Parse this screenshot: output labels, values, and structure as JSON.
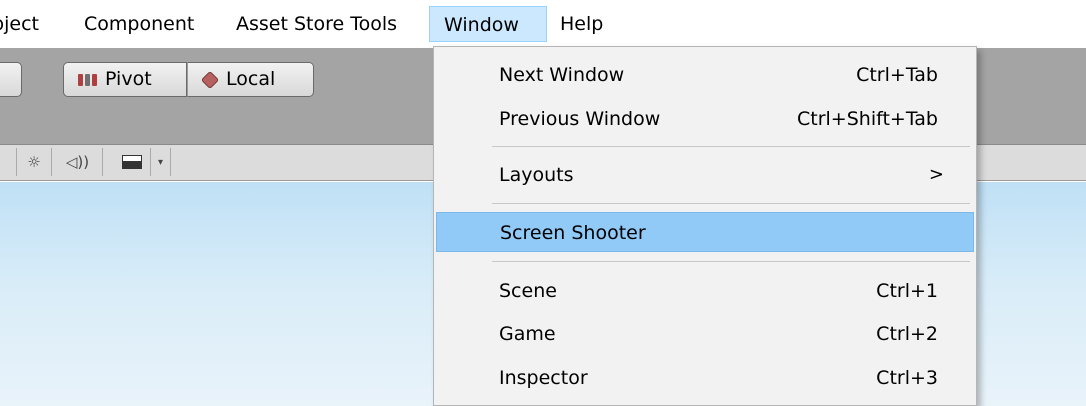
{
  "menubar": {
    "items": [
      "Project",
      "Component",
      "Asset Store Tools",
      "Window",
      "Help"
    ]
  },
  "toolbar": {
    "pivot_label": "Pivot",
    "local_label": "Local"
  },
  "window_menu": {
    "items": [
      {
        "label": "Next Window",
        "shortcut": "Ctrl+Tab"
      },
      {
        "label": "Previous Window",
        "shortcut": "Ctrl+Shift+Tab"
      },
      {
        "label": "Layouts",
        "submenu_arrow": ">"
      },
      {
        "label": "Screen Shooter",
        "highlighted": true
      },
      {
        "label": "Scene",
        "shortcut": "Ctrl+1"
      },
      {
        "label": "Game",
        "shortcut": "Ctrl+2"
      },
      {
        "label": "Inspector",
        "shortcut": "Ctrl+3"
      }
    ]
  },
  "colors": {
    "menu_hover": "#cce8ff",
    "item_highlight": "#91c9f7",
    "toolbar_bg": "#a4a4a4"
  }
}
